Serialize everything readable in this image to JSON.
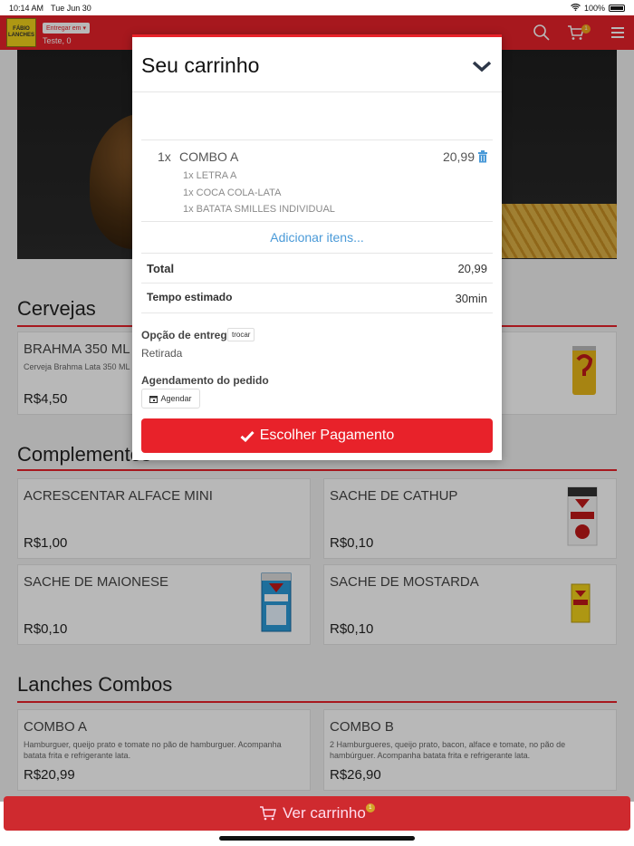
{
  "status": {
    "time": "10:14 AM",
    "date": "Tue Jun 30",
    "battery": "100%"
  },
  "header": {
    "logo_text": "FÁBIO LANCHES",
    "deliver_label": "Entregar em",
    "user_text": "Teste, 0",
    "cart_count": "1",
    "accent": "#e8222a"
  },
  "sections": [
    {
      "title": "Cervejas"
    },
    {
      "title": "Complementos"
    },
    {
      "title": "Lanches Combos"
    }
  ],
  "products": {
    "brahma": {
      "name": "BRAHMA 350 ML LA",
      "desc": "Cerveja Brahma Lata 350 ML",
      "price": "R$4,50"
    },
    "alface": {
      "name": "ACRESCENTAR ALFACE MINI",
      "price": "R$1,00"
    },
    "cathup": {
      "name": "SACHE DE CATHUP",
      "price": "R$0,10"
    },
    "maionese": {
      "name": "SACHE DE MAIONESE",
      "price": "R$0,10"
    },
    "mostarda": {
      "name": "SACHE DE MOSTARDA",
      "price": "R$0,10"
    },
    "combo_a": {
      "name": "COMBO A",
      "desc": "Hamburguer, queijo prato e tomate no pão de hamburguer. Acompanha batata frita e refrigerante lata.",
      "price": "R$20,99"
    },
    "combo_b": {
      "name": "COMBO B",
      "desc": "2 Hamburgueres, queijo prato, bacon, alface e tomate, no pão de hambúrguer. Acompanha batata frita e refrigerante lata.",
      "price": "R$26,90"
    }
  },
  "cart": {
    "title": "Seu carrinho",
    "item": {
      "qty": "1x",
      "name": "COMBO A",
      "price": "20,99",
      "subitems": [
        "1x LETRA A",
        "1x COCA COLA-LATA",
        "1x BATATA SMILLES INDIVIDUAL"
      ]
    },
    "add_more": "Adicionar itens...",
    "total_label": "Total",
    "total_value": "20,99",
    "time_label": "Tempo estimado",
    "time_value": "30min",
    "delivery_label": "Opção de entrega",
    "swap_label": "trocar",
    "delivery_value": "Retirada",
    "schedule_label": "Agendamento do pedido",
    "schedule_button": "Agendar",
    "pay_button": "Escolher Pagamento"
  },
  "bottom_bar": {
    "label": "Ver carrinho",
    "count": "1"
  }
}
